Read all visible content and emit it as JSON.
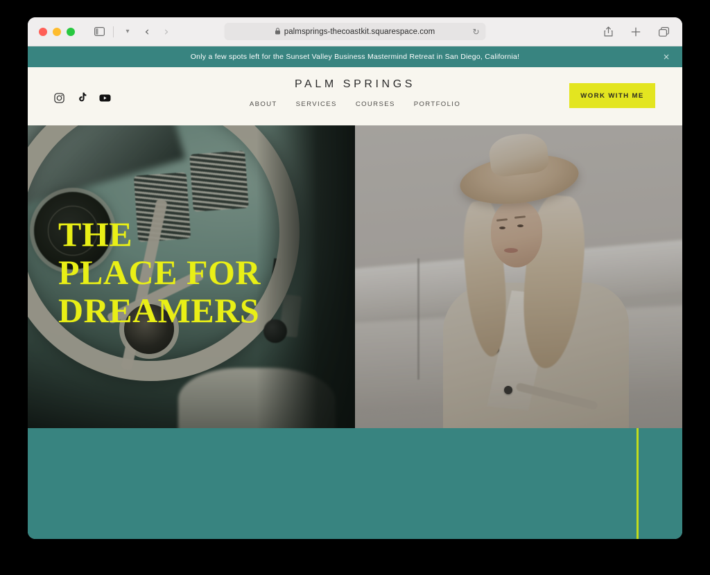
{
  "browser": {
    "traffic_lights": [
      "close",
      "minimize",
      "maximize"
    ],
    "sidebar_icon": "sidebar-icon",
    "chevron_icon": "chevron-down-icon",
    "back_label": "‹",
    "forward_label": "›",
    "url": "palmsprings-thecoastkit.squarespace.com",
    "lock_icon": "🔒",
    "reload_icon": "↻",
    "share_icon": "share-icon",
    "new_tab_icon": "plus-icon",
    "tabs_icon": "tabs-overview-icon"
  },
  "announcement": {
    "text": "Only a few spots left for the Sunset Valley Business Mastermind Retreat in San Diego, California!",
    "close_label": "×",
    "background": "#388480"
  },
  "header": {
    "brand": "PALM SPRINGS",
    "background": "#f8f6ef",
    "social": [
      {
        "name": "instagram",
        "label": "Instagram"
      },
      {
        "name": "tiktok",
        "label": "TikTok"
      },
      {
        "name": "youtube",
        "label": "YouTube"
      }
    ],
    "nav": [
      {
        "label": "ABOUT"
      },
      {
        "label": "SERVICES"
      },
      {
        "label": "COURSES"
      },
      {
        "label": "PORTFOLIO"
      }
    ],
    "cta": {
      "label": "WORK WITH ME",
      "background": "#e3e520",
      "text_color": "#2b2b20"
    }
  },
  "hero": {
    "headline": "THE\nPLACE FOR\nDREAMERS",
    "headline_color": "#e9ef16",
    "left_image_alt": "Vintage car interior with mint green dashboard and cream steering wheel",
    "right_image_alt": "Woman in wide brim hat and beige trench coat"
  },
  "section": {
    "background": "#388480",
    "accent_color": "#c3dd1c"
  }
}
